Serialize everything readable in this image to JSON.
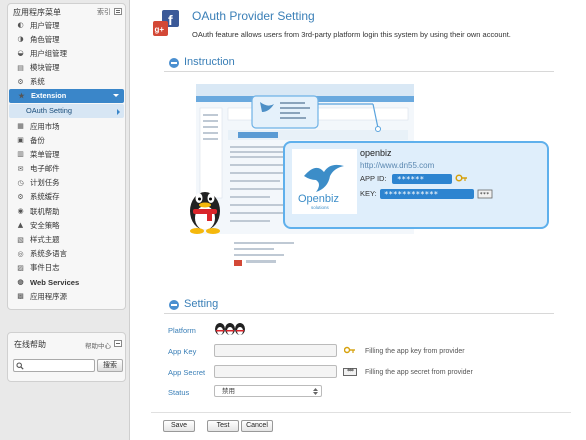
{
  "sidebar": {
    "menu_title": "应用程序菜单",
    "index_label": "索引",
    "items": [
      {
        "label": "用户管理",
        "icon": "user-icon"
      },
      {
        "label": "角色管理",
        "icon": "role-icon"
      },
      {
        "label": "用户组管理",
        "icon": "group-icon"
      },
      {
        "label": "模块管理",
        "icon": "module-icon"
      },
      {
        "label": "系统",
        "icon": "system-icon"
      }
    ],
    "extension": {
      "label": "Extension",
      "icon": "extension-icon"
    },
    "extension_active": "OAuth Setting",
    "items_after": [
      {
        "label": "应用市场",
        "icon": "market-icon"
      },
      {
        "label": "备份",
        "icon": "backup-icon"
      },
      {
        "label": "菜单管理",
        "icon": "menu-icon"
      },
      {
        "label": "电子邮件",
        "icon": "email-icon"
      },
      {
        "label": "计划任务",
        "icon": "schedule-icon"
      },
      {
        "label": "系统缓存",
        "icon": "cache-icon"
      },
      {
        "label": "联机帮助",
        "icon": "help-icon"
      },
      {
        "label": "安全策略",
        "icon": "security-icon"
      },
      {
        "label": "样式主题",
        "icon": "theme-icon"
      },
      {
        "label": "系统多语言",
        "icon": "language-icon"
      },
      {
        "label": "事件日志",
        "icon": "log-icon"
      },
      {
        "label": "Web Services",
        "icon": "webservice-icon",
        "bold": true
      },
      {
        "label": "应用程序源",
        "icon": "appsource-icon"
      }
    ],
    "help": {
      "title": "在线帮助",
      "center": "帮助中心",
      "search_button": "搜索"
    }
  },
  "main": {
    "title": "OAuth Provider Setting",
    "description": "OAuth feature allows users from 3rd-party platform login this system by using their own account.",
    "instruction_title": "Instruction",
    "setting_title": "Setting",
    "instruction_image": {
      "brand": "openbiz",
      "url": "http://www.dn55.com",
      "app_id_label": "APP ID:",
      "app_id_value": "******",
      "key_label": "KEY:",
      "key_value": "************",
      "logo_text": "Openbiz",
      "logo_sub": "solutions"
    },
    "form": {
      "platform_label": "Platform",
      "app_key_label": "App Key",
      "app_key_value": "",
      "app_key_hint": "Filling the app key from provider",
      "app_secret_label": "App Secret",
      "app_secret_value": "",
      "app_secret_hint": "Filling the app secret from provider",
      "status_label": "Status",
      "status_value": "禁用"
    },
    "buttons": {
      "save": "Save",
      "test": "Test",
      "cancel": "Cancel"
    }
  },
  "colors": {
    "accent": "#3a86c9",
    "title_blue": "#3a7fb7",
    "sidebar_bg": "#e9e9e9"
  }
}
